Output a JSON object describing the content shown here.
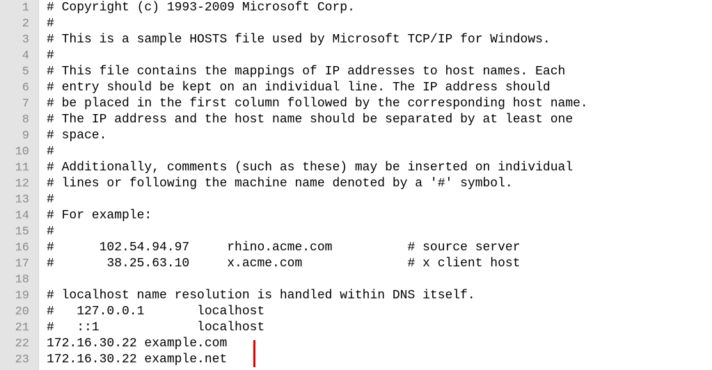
{
  "editor": {
    "lines": [
      {
        "num": "1",
        "text": "# Copyright (c) 1993-2009 Microsoft Corp."
      },
      {
        "num": "2",
        "text": "#"
      },
      {
        "num": "3",
        "text": "# This is a sample HOSTS file used by Microsoft TCP/IP for Windows."
      },
      {
        "num": "4",
        "text": "#"
      },
      {
        "num": "5",
        "text": "# This file contains the mappings of IP addresses to host names. Each"
      },
      {
        "num": "6",
        "text": "# entry should be kept on an individual line. The IP address should"
      },
      {
        "num": "7",
        "text": "# be placed in the first column followed by the corresponding host name."
      },
      {
        "num": "8",
        "text": "# The IP address and the host name should be separated by at least one"
      },
      {
        "num": "9",
        "text": "# space."
      },
      {
        "num": "10",
        "text": "#"
      },
      {
        "num": "11",
        "text": "# Additionally, comments (such as these) may be inserted on individual"
      },
      {
        "num": "12",
        "text": "# lines or following the machine name denoted by a '#' symbol."
      },
      {
        "num": "13",
        "text": "#"
      },
      {
        "num": "14",
        "text": "# For example:"
      },
      {
        "num": "15",
        "text": "#"
      },
      {
        "num": "16",
        "text": "#      102.54.94.97     rhino.acme.com          # source server"
      },
      {
        "num": "17",
        "text": "#       38.25.63.10     x.acme.com              # x client host"
      },
      {
        "num": "18",
        "text": ""
      },
      {
        "num": "19",
        "text": "# localhost name resolution is handled within DNS itself."
      },
      {
        "num": "20",
        "text": "#   127.0.0.1       localhost"
      },
      {
        "num": "21",
        "text": "#   ::1             localhost"
      },
      {
        "num": "22",
        "text": "172.16.30.22 example.com"
      },
      {
        "num": "23",
        "text": "172.16.30.22 example.net"
      }
    ]
  },
  "colors": {
    "gutter_background": "#e4e4e4",
    "line_number": "#8a8a8a",
    "text": "#000000",
    "marker": "#e00000"
  }
}
